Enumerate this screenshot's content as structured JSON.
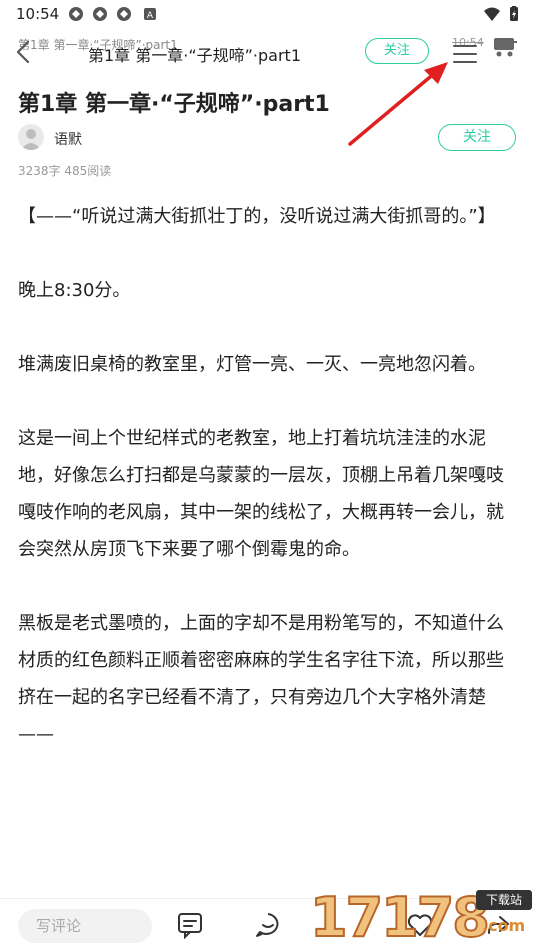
{
  "status_bar": {
    "time": "10:54"
  },
  "nav": {
    "ghost_title": "第1章 第一章·“子规啼”·part1",
    "title": "第1章 第一章·“子规啼”·part1",
    "follow_label": "关注",
    "ghost_time": "10:54"
  },
  "article": {
    "title": "第1章 第一章·“子规啼”·part1",
    "author": "语默",
    "follow_label": "关注",
    "stats": "3238字 485阅读",
    "paragraphs": [
      "【——“听说过满大街抓壮丁的，没听说过满大街抓哥的。”】",
      "晚上8:30分。",
      "堆满废旧桌椅的教室里，灯管一亮、一灭、一亮地忽闪着。",
      "这是一间上个世纪样式的老教室，地上打着坑坑洼洼的水泥地，好像怎么打扫都是乌蒙蒙的一层灰，顶棚上吊着几架嘎吱嘎吱作响的老风扇，其中一架的线松了，大概再转一会儿，就会突然从房顶飞下来要了哪个倒霉鬼的命。",
      "黑板是老式墨喷的，上面的字却不是用粉笔写的，不知道什么材质的红色颜料正顺着密密麻麻的学生名字往下流，所以那些挤在一起的名字已经看不清了，只有旁边几个大字格外清楚——"
    ]
  },
  "bottom_bar": {
    "comment_placeholder": "写评论"
  },
  "watermark": {
    "digits": "17178",
    "badge": "下载站",
    "domain": ".com"
  },
  "colors": {
    "accent": "#2ccba0",
    "annotation_arrow": "#e02020"
  },
  "icons": [
    "wifi-icon",
    "battery-icon",
    "back-icon",
    "menu-icon",
    "cart-icon",
    "user-avatar-icon",
    "comment-list-icon",
    "chat-bubble-icon",
    "heart-icon",
    "share-icon"
  ]
}
